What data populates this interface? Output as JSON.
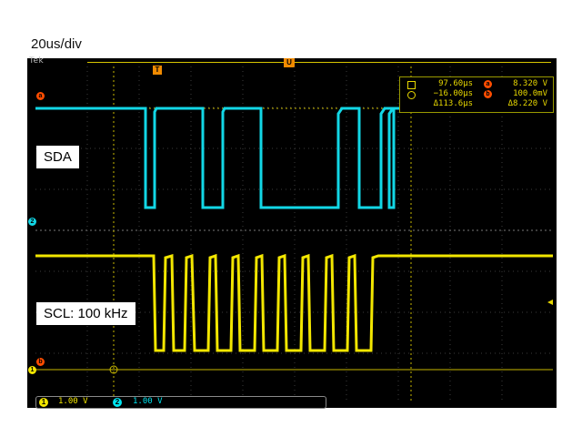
{
  "timebase_label": "20us/div",
  "brand": "Tek",
  "trigger_markers": {
    "t": "T",
    "u": "U"
  },
  "cursor_readout": {
    "rows": [
      {
        "time": "97.60µs",
        "badge": "a",
        "value": "8.320 V"
      },
      {
        "time": "−16.00µs",
        "badge": "b",
        "value": "100.0mV"
      },
      {
        "time": "Δ113.6µs",
        "badge": "",
        "value": "Δ8.220 V"
      }
    ]
  },
  "signal_labels": {
    "sda": "SDA",
    "scl": "SCL: 100 kHz"
  },
  "channel_markers": {
    "a": "a",
    "two": "2",
    "b": "b",
    "one": "1"
  },
  "channels": [
    {
      "badge": "1",
      "scale": "1.00 V",
      "color": "#f2e600"
    },
    {
      "badge": "2",
      "scale": "1.00 V",
      "color": "#00e5f0"
    }
  ],
  "colors": {
    "ch1": "#f2e600",
    "ch2": "#12d7e6",
    "grid": "#3a3a3a",
    "cursor": "#e8d800",
    "marker": "#ff4d00"
  }
}
